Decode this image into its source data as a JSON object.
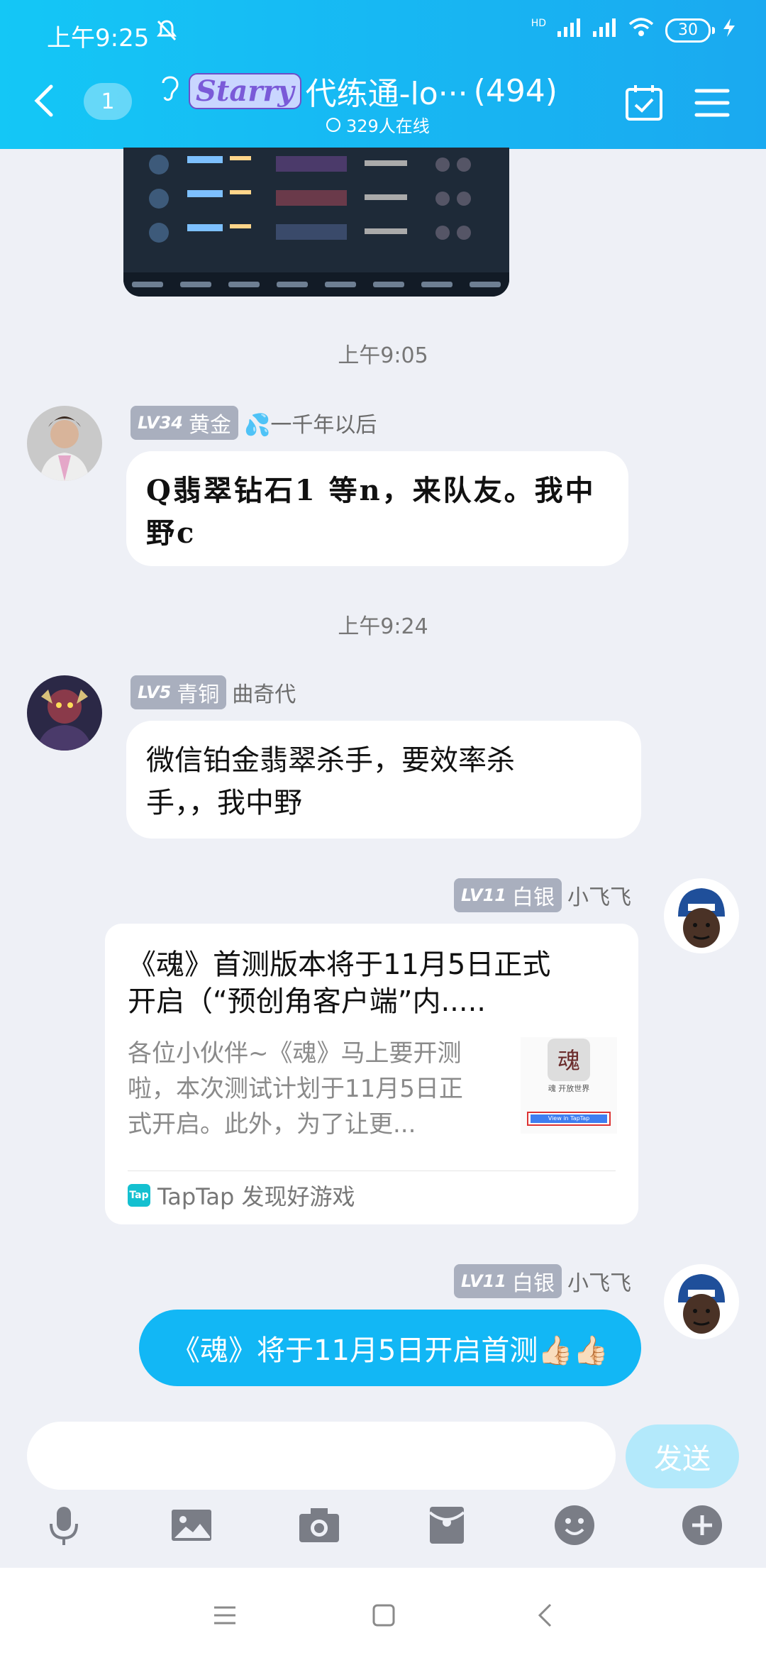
{
  "status_bar": {
    "time": "上午9:25",
    "network_label": "HD",
    "battery": "30"
  },
  "header": {
    "unread_count": "1",
    "group_name": "代练通-lo···",
    "member_count": "(494)",
    "online_text": "329人在线",
    "logo_text": "Starry"
  },
  "messages": [
    {
      "timestamp": "上午9:05",
      "level": "LV34",
      "rank": "黄金",
      "sender": "💦一千年以后",
      "text_line1": "Q翡翠钻石1 等n，来队友。我中",
      "text_line2": "野c"
    },
    {
      "timestamp": "上午9:24",
      "level": "LV5",
      "rank": "青铜",
      "sender": "曲奇代",
      "text_line1": "微信铂金翡翠杀手，要效率杀",
      "text_line2": "手，，我中野"
    },
    {
      "level": "LV11",
      "rank": "白银",
      "sender": "小飞飞",
      "card": {
        "title_line1": "《魂》首测版本将于11月5日正式",
        "title_line2": "开启（“预创角客户端”内.....",
        "desc_line1": "各位小伙伴~《魂》马上要开测",
        "desc_line2": "啦，本次测试计划于11月5日正",
        "desc_line3": "式开启。此外，为了让更...",
        "source": "TapTap 发现好游戏",
        "source_logo": "Tap",
        "thumb_caption": "魂 开放世界",
        "thumb_button": "View in TapTap"
      }
    },
    {
      "level": "LV11",
      "rank": "白银",
      "sender": "小飞飞",
      "text": "《魂》将于11月5日开启首测👍🏻👍🏻"
    }
  ],
  "composer": {
    "input_value": "",
    "send_label": "发送"
  },
  "colors": {
    "header": "#14c7f6",
    "bubble_self": "#12b7f5",
    "background": "#eef0f6"
  }
}
